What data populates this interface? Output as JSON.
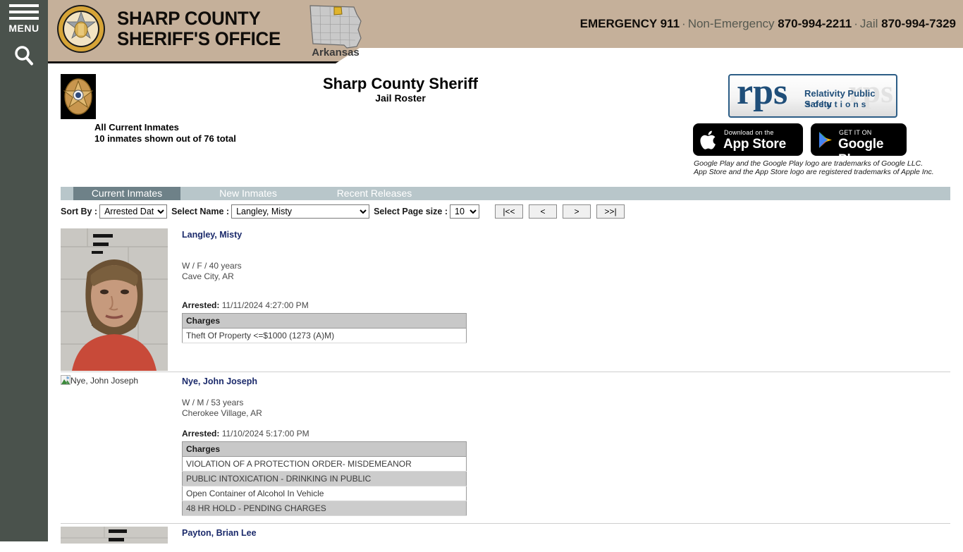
{
  "sidebar": {
    "menu_label": "MENU",
    "search_icon": "search-icon",
    "hamburger_icon": "hamburger-icon"
  },
  "banner": {
    "title_line1": "SHARP COUNTY",
    "title_line2": "SHERIFF'S OFFICE",
    "state_label": "Arkansas",
    "seal_icon": "sheriff-badge-seal-icon",
    "map_icon": "arkansas-map-icon",
    "emergency_label": "EMERGENCY 911",
    "nonemergency_label": "Non-Emergency",
    "nonemergency_number": "870-994-2211",
    "jail_label": "Jail",
    "jail_number": "870-994-7329",
    "separator": "·",
    "bg_color": "#c5b09a"
  },
  "page": {
    "title": "Sharp County Sheriff",
    "subtitle": "Jail Roster",
    "seal_icon": "sheriff-star-badge-icon",
    "summary_line1": "All Current Inmates",
    "summary_line2": "10 inmates shown out of 76 total"
  },
  "vendor": {
    "logo_mark": "rps",
    "logo_ghost": "rps",
    "logo_line1": "Relativity Public Safety",
    "logo_line2": "solutions",
    "appstore_small": "Download on the",
    "appstore_big": "App Store",
    "appstore_icon": "apple-logo-icon",
    "googleplay_small": "GET IT ON",
    "googleplay_big": "Google Play",
    "googleplay_icon": "google-play-triangle-icon",
    "trademark_line1": "Google Play and the Google Play logo are trademarks of Google LLC.",
    "trademark_line2": "App Store and the App Store logo are registered trademarks of Apple Inc.",
    "brand_color": "#1f4e79"
  },
  "tabs": [
    {
      "label": "Current Inmates",
      "active": true
    },
    {
      "label": "New Inmates",
      "active": false
    },
    {
      "label": "Recent Releases",
      "active": false
    }
  ],
  "controls": {
    "sort_label": "Sort By :",
    "sort_value": "Arrested Date",
    "sort_options": [
      "Arrested Date"
    ],
    "name_label": "Select Name :",
    "name_value": "Langley, Misty",
    "name_options": [
      "Langley, Misty"
    ],
    "pagesize_label": "Select Page size :",
    "pagesize_value": "10",
    "pagesize_options": [
      "10"
    ],
    "pager": [
      {
        "label": "|<<",
        "name": "first-page-button"
      },
      {
        "label": "<",
        "name": "previous-page-button"
      },
      {
        "label": ">",
        "name": "next-page-button"
      },
      {
        "label": ">>|",
        "name": "last-page-button"
      }
    ]
  },
  "charges_header": "Charges",
  "arrested_label": "Arrested:",
  "inmates": [
    {
      "name": "Langley, Misty",
      "photo": "mugshot",
      "demographics": "W / F / 40 years",
      "city": "Cave City, AR",
      "arrested": "11/11/2024 4:27:00 PM",
      "charges": [
        "Theft Of Property <=$1000 (1273 (A)M)"
      ]
    },
    {
      "name": "Nye, John Joseph",
      "photo": "broken",
      "demographics": "W / M / 53 years",
      "city": "Cherokee Village, AR",
      "arrested": "11/10/2024 5:17:00 PM",
      "charges": [
        "VIOLATION OF A PROTECTION ORDER- MISDEMEANOR",
        "PUBLIC INTOXICATION - DRINKING IN PUBLIC",
        "Open Container of Alcohol In Vehicle",
        "48 HR HOLD - PENDING CHARGES"
      ]
    },
    {
      "name": "Payton, Brian Lee",
      "photo": "mugshot-partial",
      "demographics": "",
      "city": "",
      "arrested": "",
      "charges": []
    }
  ]
}
